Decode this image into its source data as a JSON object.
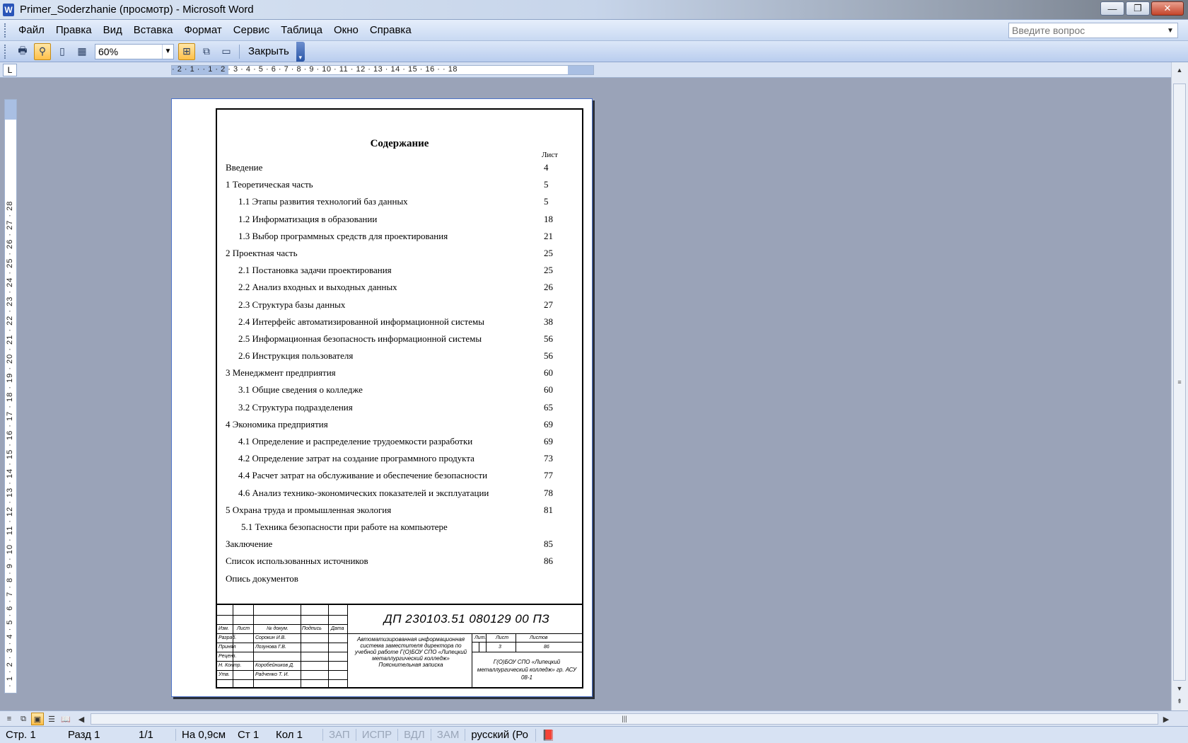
{
  "window": {
    "title": "Primer_Soderzhanie (просмотр) - Microsoft Word",
    "app_icon": "W",
    "min": "—",
    "max": "❐",
    "close": "✕"
  },
  "menu": [
    "Файл",
    "Правка",
    "Вид",
    "Вставка",
    "Формат",
    "Сервис",
    "Таблица",
    "Окно",
    "Справка"
  ],
  "help": {
    "placeholder": "Введите вопрос"
  },
  "toolbar": {
    "zoom": "60%",
    "close_label": "Закрыть"
  },
  "ruler": {
    "horizontal": "· 2 · 1 ·   · 1 · 2 · 3 · 4 · 5 · 6 · 7 · 8 · 9 · 10 · 11 · 12 · 13 · 14 · 15 · 16 ·   · 18",
    "vertical": "· 1 · 2 · 3 · 4 · 5 · 6 · 7 · 8 · 9 · 10 · 11 · 12 · 13 · 14 · 15 · 16 · 17 · 18 · 19 · 20 · 21 · 22 · 23 · 24 · 25 · 26 · 27 · 28",
    "corner": "L"
  },
  "document": {
    "title": "Содержание",
    "page_header": "Лист",
    "toc": [
      {
        "text": "Введение",
        "page": "4",
        "level": 0
      },
      {
        "text": "1  Теоретическая часть",
        "page": "5",
        "level": 0
      },
      {
        "text": "1.1 Этапы развития технологий баз данных",
        "page": "5",
        "level": 1
      },
      {
        "text": "1.2 Информатизация в образовании",
        "page": "18",
        "level": 1
      },
      {
        "text": "1.3 Выбор программных средств для проектирования",
        "page": "21",
        "level": 1
      },
      {
        "text": "2  Проектная часть",
        "page": "25",
        "level": 0
      },
      {
        "text": "2.1 Постановка задачи проектирования",
        "page": "25",
        "level": 1
      },
      {
        "text": "2.2 Анализ входных и выходных данных",
        "page": "26",
        "level": 1
      },
      {
        "text": "2.3 Структура базы данных",
        "page": "27",
        "level": 1
      },
      {
        "text": "2.4 Интерфейс автоматизированной информационной системы",
        "page": "38",
        "level": 1
      },
      {
        "text": "2.5 Информационная безопасность  информационной системы",
        "page": "56",
        "level": 1
      },
      {
        "text": "2.6 Инструкция пользователя",
        "page": "56",
        "level": 1
      },
      {
        "text": "3  Менеджмент предприятия",
        "page": "60",
        "level": 0
      },
      {
        "text": "3.1 Общие сведения о колледже",
        "page": "60",
        "level": 1
      },
      {
        "text": "3.2 Структура подразделения",
        "page": "65",
        "level": 1
      },
      {
        "text": "4  Экономика предприятия",
        "page": "69",
        "level": 0
      },
      {
        "text": "4.1 Определение и распределение трудоемкости разработки",
        "page": "69",
        "level": 1
      },
      {
        "text": "4.2 Определение затрат на создание программного продукта",
        "page": "73",
        "level": 1
      },
      {
        "text": "4.4 Расчет затрат на обслуживание и обеспечение безопасности",
        "page": "77",
        "level": 1
      },
      {
        "text": "4.6 Анализ технико-экономических показателей и эксплуатации",
        "page": "78",
        "level": 1
      },
      {
        "text": "5 Охрана труда и промышленная экология",
        "page": "81",
        "level": 0
      },
      {
        "text": "5.1 Техника безопасности при работе на компьютере",
        "page": "",
        "level": 2
      },
      {
        "text": "Заключение",
        "page": "85",
        "level": 0
      },
      {
        "text": "Список использованных источников",
        "page": "86",
        "level": 0
      },
      {
        "text": "Опись документов",
        "page": "",
        "level": 0
      }
    ],
    "stamp": {
      "code": "ДП  230103.51  080129  00  ПЗ",
      "col_izm": "Изм.",
      "col_list": "Лист",
      "col_doc": "№ докум.",
      "col_sign": "Подпись",
      "col_date": "Дата",
      "razrab": "Разраб.",
      "razrab_name": "Сорокин И.В.",
      "prinyal": "Принял",
      "prinyal_name": "Лозунова  Г.В.",
      "recenz": "Реценз.",
      "nkontr": "Н. Контр.",
      "nkontr_name": "Коробейников Д.",
      "utv": "Утв.",
      "utv_name": "Радченко  Т. И.",
      "desc": "Автоматизированная информационная система заместителя директора по учебной работе Г(О)БОУ СПО «Липецкий металлургический колледж» Пояснительная записка",
      "lit": "Лит.",
      "list": "Лист",
      "listov": "Листов",
      "list_val": "3",
      "listov_val": "86",
      "org": "Г(О)БОУ СПО «Липецкий металлургический колледж» гр. АСУ 08-1"
    }
  },
  "status": {
    "page": "Стр. 1",
    "section": "Разд 1",
    "pages": "1/1",
    "at": "На 0,9см",
    "line": "Ст 1",
    "col": "Кол 1",
    "rec": "ЗАП",
    "trk": "ИСПР",
    "ext": "ВДЛ",
    "ovr": "ЗАМ",
    "lang": "русский (Ро"
  }
}
